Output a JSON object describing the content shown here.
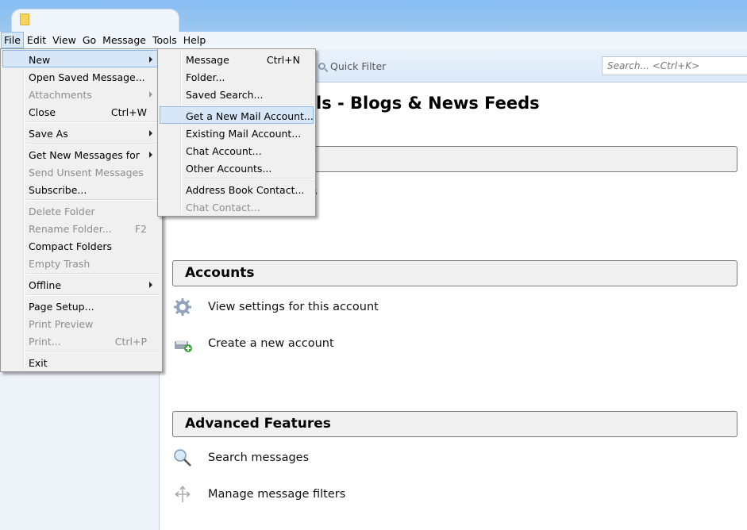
{
  "menubar": [
    {
      "label": "File",
      "key": "F"
    },
    {
      "label": "Edit",
      "key": "E"
    },
    {
      "label": "View",
      "key": "V"
    },
    {
      "label": "Go",
      "key": "G"
    },
    {
      "label": "Message",
      "key": "M"
    },
    {
      "label": "Tools",
      "key": "T"
    },
    {
      "label": "Help",
      "key": "H"
    }
  ],
  "toolbar": {
    "quick_filter": "Quick Filter",
    "search_placeholder": "Search... <Ctrl+K>"
  },
  "main": {
    "title_visible": "ls - Blogs & News Feeds",
    "hidden_row_fragment": "s",
    "sections": [
      {
        "title": "Accounts",
        "items": [
          {
            "label": "View settings for this account",
            "icon": "gear-icon"
          },
          {
            "label": "Create a new account",
            "icon": "new-account-icon"
          }
        ]
      },
      {
        "title": "Advanced Features",
        "items": [
          {
            "label": "Search messages",
            "icon": "magnifier-icon"
          },
          {
            "label": "Manage message filters",
            "icon": "filter-icon"
          }
        ]
      }
    ]
  },
  "file_menu": [
    {
      "label": "New",
      "key": "N",
      "submenu": true,
      "highlighted": true
    },
    {
      "label": "Open Saved Message...",
      "key": "O"
    },
    {
      "label": "Attachments",
      "key": "A",
      "disabled": true,
      "submenu": true
    },
    {
      "label": "Close",
      "key": "C",
      "shortcut": "Ctrl+W"
    },
    {
      "sep": true
    },
    {
      "label": "Save As",
      "key": "S",
      "submenu": true
    },
    {
      "sep": true
    },
    {
      "label": "Get New Messages for",
      "key": "w",
      "submenu": true
    },
    {
      "label": "Send Unsent Messages",
      "key": "d",
      "disabled": true
    },
    {
      "label": "Subscribe...",
      "key": "b"
    },
    {
      "sep": true
    },
    {
      "label": "Delete Folder",
      "key": "e",
      "disabled": true
    },
    {
      "label": "Rename Folder...",
      "key": "R",
      "shortcut": "F2",
      "disabled": true
    },
    {
      "label": "Compact Folders",
      "key": "F"
    },
    {
      "label": "Empty Trash",
      "key": "y",
      "disabled": true
    },
    {
      "sep": true
    },
    {
      "label": "Offline",
      "key": "l",
      "submenu": true
    },
    {
      "sep": true
    },
    {
      "label": "Page Setup...",
      "key": "u"
    },
    {
      "label": "Print Preview",
      "key": "v",
      "disabled": true
    },
    {
      "label": "Print...",
      "key": "P",
      "shortcut": "Ctrl+P",
      "disabled": true
    },
    {
      "sep": true
    },
    {
      "label": "Exit",
      "key": "x"
    }
  ],
  "new_submenu": [
    {
      "label": "Message",
      "key": "M",
      "shortcut": "Ctrl+N"
    },
    {
      "label": "Folder...",
      "key": "F"
    },
    {
      "label": "Saved Search...",
      "key": "S"
    },
    {
      "sep": true
    },
    {
      "label": "Get a New Mail Account...",
      "key": "G",
      "highlighted": true
    },
    {
      "label": "Existing Mail Account...",
      "key": "E"
    },
    {
      "label": "Chat Account...",
      "key": "C"
    },
    {
      "label": "Other Accounts...",
      "key": "O"
    },
    {
      "sep": true
    },
    {
      "label": "Address Book Contact...",
      "key": "C"
    },
    {
      "label": "Chat Contact...",
      "key": "h",
      "disabled": true
    }
  ]
}
